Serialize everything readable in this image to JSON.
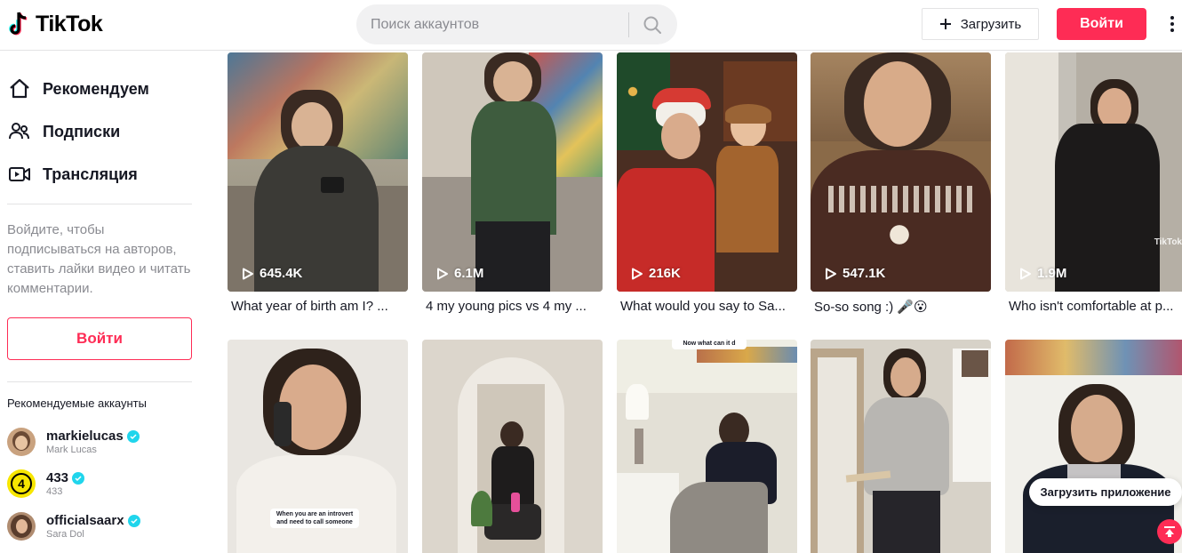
{
  "header": {
    "logo_text": "TikTok",
    "search_placeholder": "Поиск аккаунтов",
    "upload_label": "Загрузить",
    "login_label": "Войти"
  },
  "sidebar": {
    "nav": [
      {
        "label": "Рекомендуем",
        "icon": "home-icon"
      },
      {
        "label": "Подписки",
        "icon": "following-icon"
      },
      {
        "label": "Трансляция",
        "icon": "live-icon"
      }
    ],
    "login_hint": "Войдите, чтобы подписываться на авторов, ставить лайки видео и читать комментарии.",
    "login_button": "Войти",
    "recommended_title": "Рекомендуемые аккаунты",
    "accounts": [
      {
        "username": "markielucas",
        "name": "Mark Lucas",
        "verified": true
      },
      {
        "username": "433",
        "name": "433",
        "verified": true
      },
      {
        "username": "officialsaarx",
        "name": "Sara Dol",
        "verified": true
      }
    ]
  },
  "videos": [
    {
      "views": "645.4K",
      "caption": "What year of birth am I? ..."
    },
    {
      "views": "6.1M",
      "caption": "4 my young pics vs 4 my ..."
    },
    {
      "views": "216K",
      "caption": "What would you say to Sa..."
    },
    {
      "views": "547.1K",
      "caption": "So-so song :) 🎤😮"
    },
    {
      "views": "1.9M",
      "caption": "Who isn't comfortable at p..."
    },
    {
      "overlay": "When you are an introvert and need to call someone"
    },
    {},
    {
      "overlay": "Now what can it d"
    },
    {},
    {}
  ],
  "watermark_text": "TikTok",
  "floating": {
    "get_app_label": "Загрузить приложение"
  },
  "colors": {
    "brand": "#fe2c55",
    "verified": "#20d5ec",
    "muted_text": "#8a8b91"
  }
}
